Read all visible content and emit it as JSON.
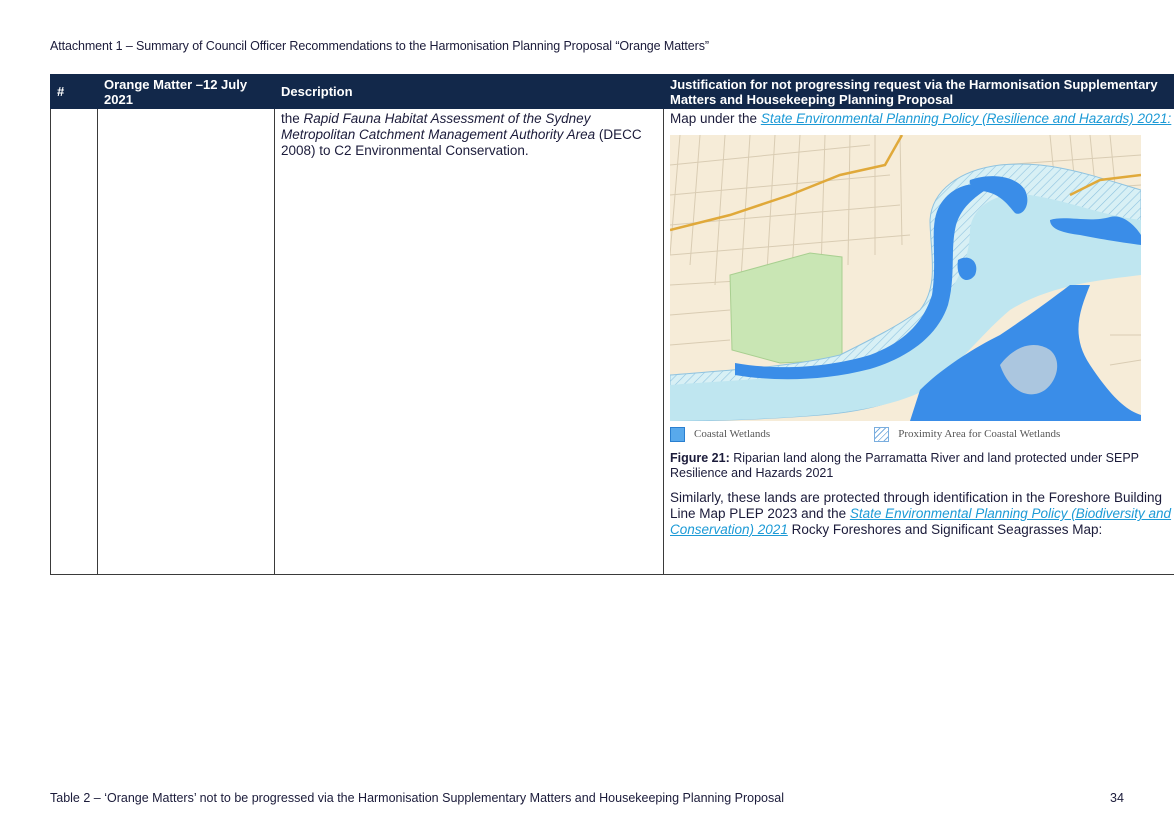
{
  "header": {
    "title": "Attachment 1 – Summary of Council Officer Recommendations to the Harmonisation Planning Proposal “Orange Matters”"
  },
  "table": {
    "columns": [
      "#",
      "Orange Matter –12 July 2021",
      "Description",
      "Justification for not progressing request via the Harmonisation Supplementary Matters and Housekeeping Planning Proposal"
    ],
    "row": {
      "number": "",
      "matter": "",
      "description": {
        "part1": "the ",
        "italic": "Rapid Fauna Habitat Assessment of the Sydney Metropolitan Catchment Management Authority Area",
        "part2": " (DECC 2008) to C2 Environmental Conservation."
      },
      "justification": {
        "intro": "Map under the ",
        "intro_link": "State Environmental Planning Policy (Resilience and Hazards) 2021",
        "intro_end": ":",
        "legend_wetlands": "Coastal Wetlands",
        "legend_proximity": "Proximity Area for Coastal Wetlands",
        "figure_label": "Figure 21:",
        "figure_caption": " Riparian land along the Parramatta River and land protected under SEPP Resilience and Hazards 2021",
        "para_start": "Similarly, these lands are protected through identification in the Foreshore Building Line Map PLEP 2023 and the ",
        "para_link": "State Environmental Planning Policy (Biodiversity and Conservation) 2021",
        "para_end": " Rocky Foreshores and Significant Seagrasses Map:"
      }
    }
  },
  "map": {
    "colors": {
      "land": "#f6ecd8",
      "road": "#e8dcc4",
      "wetland": "#3a8de8",
      "proximity": "#bfe6f0",
      "park": "#c9e6b4",
      "boundary": "#e0a93a"
    }
  },
  "footer": {
    "text": "Table 2 – ‘Orange Matters’ not to be progressed via the Harmonisation Supplementary Matters and Housekeeping Planning Proposal",
    "page_number": "34"
  }
}
